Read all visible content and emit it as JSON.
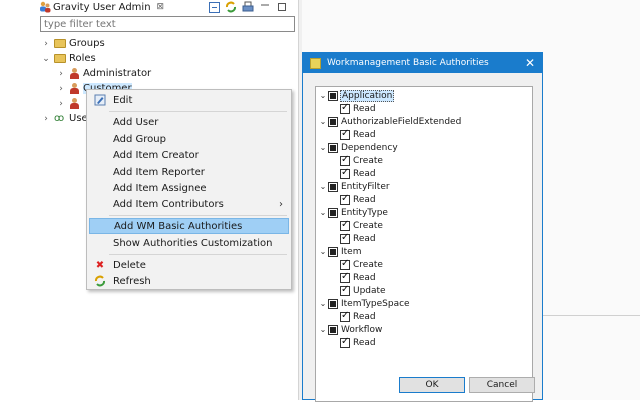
{
  "view": {
    "title": "Gravity User Admin",
    "close_glyph": "⊠",
    "filter_placeholder": "type filter text",
    "toolbar_icons": [
      "collapse-all-icon",
      "refresh-icon",
      "print-icon",
      "minimize-icon",
      "maximize-icon"
    ],
    "tree": [
      {
        "label": "Groups",
        "icon": "folder-icon",
        "expanded": false
      },
      {
        "label": "Roles",
        "icon": "folder-icon",
        "expanded": true
      },
      {
        "label": "Administrator",
        "icon": "role-icon",
        "expanded": false
      },
      {
        "label": "Customer",
        "icon": "role-icon",
        "expanded": false,
        "selected": true
      },
      {
        "label": "",
        "icon": "role-icon",
        "expanded": false
      },
      {
        "label": "Use",
        "icon": "users-icon",
        "expanded": false
      }
    ]
  },
  "context_menu": {
    "items": [
      {
        "label": "Edit",
        "icon": "edit-icon"
      },
      {
        "label": "Add User"
      },
      {
        "label": "Add Group"
      },
      {
        "label": "Add Item Creator"
      },
      {
        "label": "Add Item Reporter"
      },
      {
        "label": "Add Item Assignee"
      },
      {
        "label": "Add Item Contributors",
        "submenu": true
      },
      {
        "label": "Add WM Basic Authorities",
        "highlighted": true
      },
      {
        "label": "Show Authorities Customization"
      },
      {
        "label": "Delete",
        "icon": "delete-icon"
      },
      {
        "label": "Refresh",
        "icon": "refresh-icon"
      }
    ]
  },
  "dialog": {
    "title": "Workmanagement Basic Authorities",
    "close_glyph": "✕",
    "tree": [
      {
        "label": "Application",
        "children": [
          "Read"
        ]
      },
      {
        "label": "AuthorizableFieldExtended",
        "children": [
          "Read"
        ]
      },
      {
        "label": "Dependency",
        "children": [
          "Create",
          "Read"
        ]
      },
      {
        "label": "EntityFilter",
        "children": [
          "Read"
        ]
      },
      {
        "label": "EntityType",
        "children": [
          "Create",
          "Read"
        ]
      },
      {
        "label": "Item",
        "children": [
          "Create",
          "Read",
          "Update"
        ]
      },
      {
        "label": "ItemTypeSpace",
        "children": [
          "Read"
        ]
      },
      {
        "label": "Workflow",
        "children": [
          "Read"
        ]
      }
    ],
    "ok_label": "OK",
    "cancel_label": "Cancel"
  },
  "colors": {
    "accent": "#1a7ccc",
    "menu_highlight": "#9fcff5",
    "selection": "#cde8ff"
  }
}
